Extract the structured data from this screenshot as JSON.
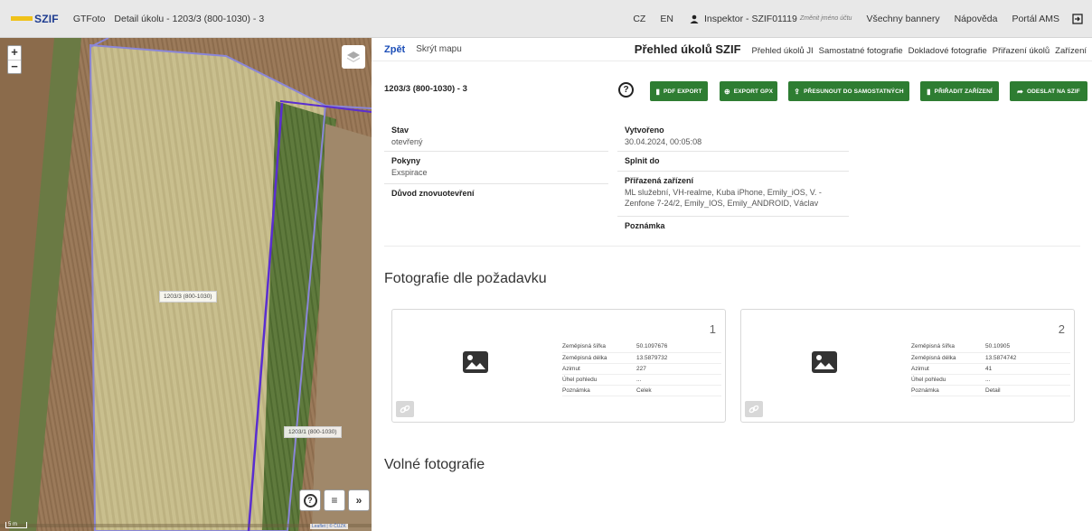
{
  "topbar": {
    "logo": "SZIF",
    "app_name": "GTFoto",
    "task_title": "Detail úkolu - 1203/3 (800-1030) - 3",
    "lang_cz": "CZ",
    "lang_en": "EN",
    "user": "Inspektor - SZIF01119",
    "user_sub": "Změnit jméno účtu",
    "links": [
      "Všechny bannery",
      "Nápověda",
      "Portál AMS"
    ],
    "brand_color": "#f0c21a"
  },
  "map": {
    "parcel_labels": [
      "1203/3 (800-1030)",
      "1203/1 (800-1030)"
    ],
    "scale": "5 m",
    "attribution": "Leaflet | © ČÚZK",
    "zoom_in": "+",
    "zoom_out": "−",
    "ctrl_help": "?",
    "ctrl_list": "≡",
    "ctrl_expand": "»"
  },
  "subnav": {
    "back": "Zpět",
    "hide_map": "Skrýt mapu",
    "main": "Přehled úkolů SZIF",
    "links": [
      "Přehled úkolů JI",
      "Samostatné fotografie",
      "Dokladové fotografie",
      "Přiřazení úkolů",
      "Zařízení"
    ]
  },
  "task": {
    "id": "1203/3 (800-1030) - 3",
    "help": "?",
    "buttons": [
      "PDF EXPORT",
      "EXPORT GPX",
      "PŘESUNOUT DO SAMOSTATNÝCH",
      "PŘIŘADIT ZAŘÍZENÍ",
      "ODESLAT NA SZIF"
    ],
    "button_color": "#2e7d32"
  },
  "info": {
    "left": [
      {
        "label": "Stav",
        "value": "otevřený"
      },
      {
        "label": "Pokyny",
        "value": "Exspirace"
      },
      {
        "label": "Důvod znovuotevření",
        "value": ""
      }
    ],
    "right": [
      {
        "label": "Vytvořeno",
        "value": "30.04.2024, 00:05:08"
      },
      {
        "label": "Splnit do",
        "value": ""
      },
      {
        "label": "Přiřazená zařízení",
        "value": "ML služební, VH-realme, Kuba iPhone, Emily_iOS, V. - Zenfone 7-24/2, Emily_IOS, Emily_ANDROID, Václav"
      },
      {
        "label": "Poznámka",
        "value": ""
      }
    ]
  },
  "sections": {
    "requested": "Fotografie dle požadavku",
    "free": "Volné fotografie"
  },
  "photos": [
    {
      "num": "1",
      "rows": [
        [
          "Zeměpisná šířka",
          "50.1097676"
        ],
        [
          "Zeměpisná délka",
          "13.5879732"
        ],
        [
          "Azimut",
          "227"
        ],
        [
          "Úhel pohledu",
          "..."
        ],
        [
          "Poznámka",
          "Celek"
        ]
      ]
    },
    {
      "num": "2",
      "rows": [
        [
          "Zeměpisná šířka",
          "50.10905"
        ],
        [
          "Zeměpisná délka",
          "13.5874742"
        ],
        [
          "Azimut",
          "41"
        ],
        [
          "Úhel pohledu",
          "..."
        ],
        [
          "Poznámka",
          "Detail"
        ]
      ]
    }
  ]
}
